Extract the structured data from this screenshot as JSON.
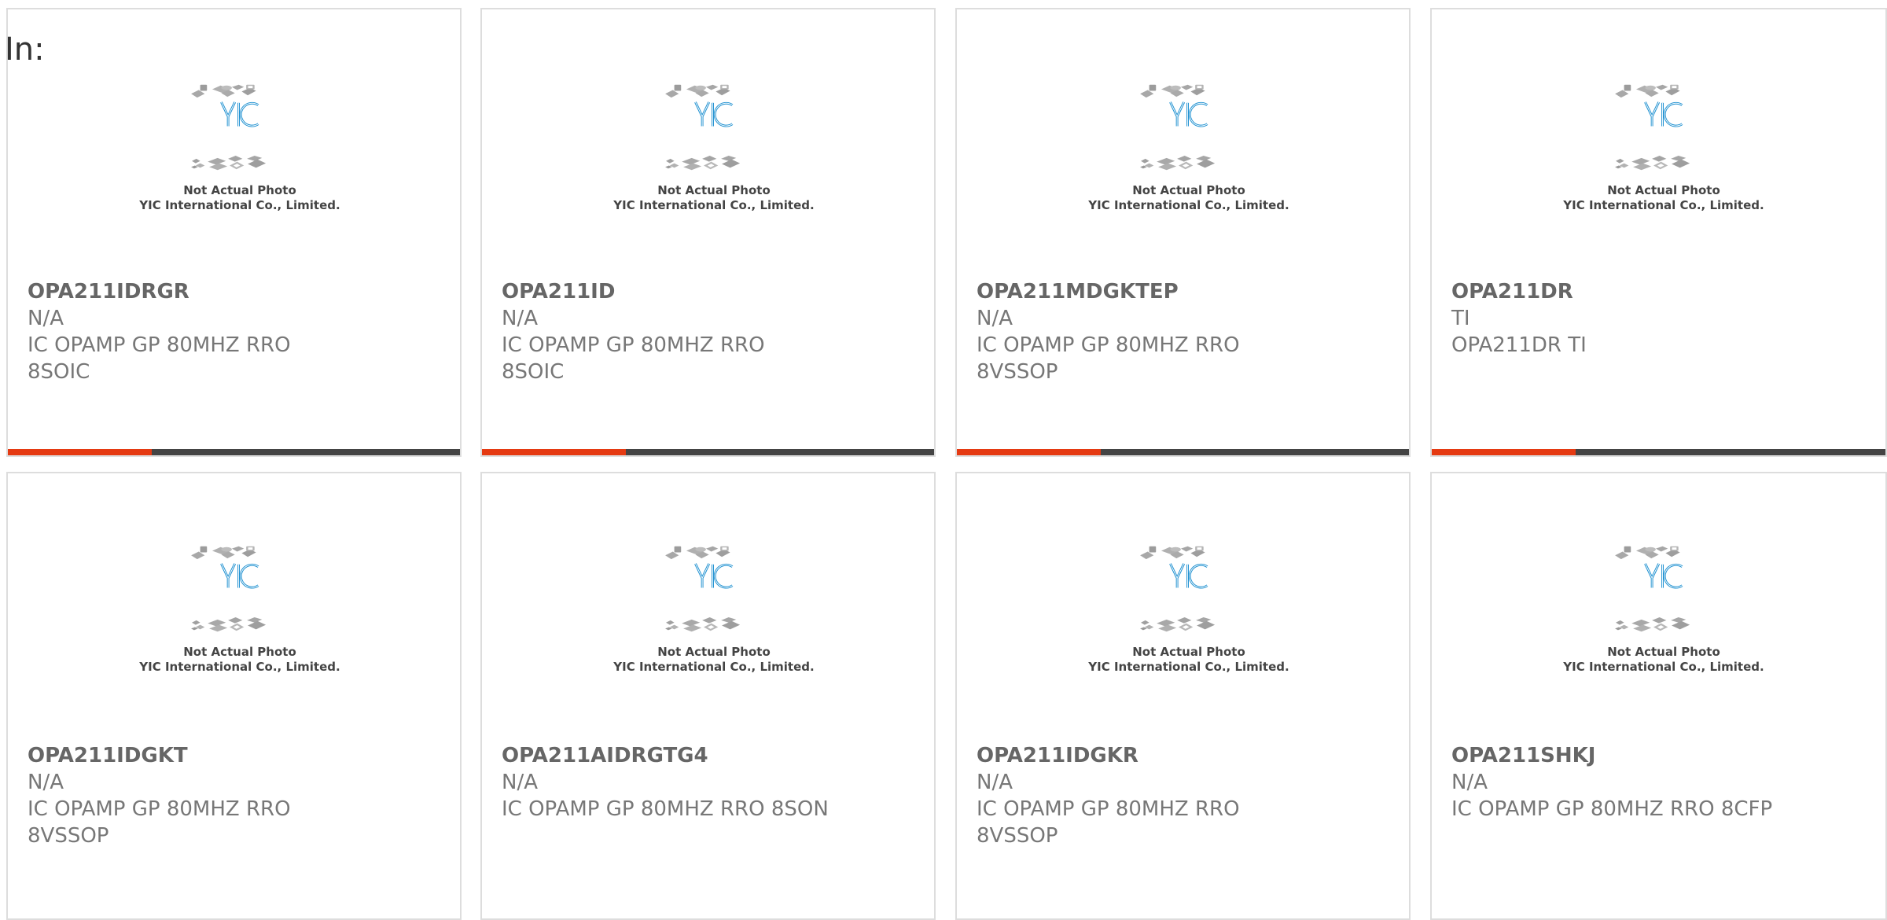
{
  "header": {
    "in_label": "In:"
  },
  "placeholder": {
    "logo_text": "YIC",
    "caption_line1": "Not Actual Photo",
    "caption_line2": "YIC International Co., Limited."
  },
  "colors": {
    "accent": "#e53a12",
    "bar": "#444444",
    "logo_blue": "#1b8fd0"
  },
  "products": [
    {
      "part_number": "OPA211IDRGR",
      "manufacturer": "N/A",
      "description": "IC OPAMP GP 80MHZ RRO 8SOIC"
    },
    {
      "part_number": "OPA211ID",
      "manufacturer": "N/A",
      "description": "IC OPAMP GP 80MHZ RRO 8SOIC"
    },
    {
      "part_number": "OPA211MDGKTEP",
      "manufacturer": "N/A",
      "description_line1": "IC OPAMP GP 80MHZ RRO",
      "description_line2": "8VSSOP"
    },
    {
      "part_number": "OPA211DR",
      "manufacturer": "TI",
      "description": "OPA211DR TI"
    },
    {
      "part_number": "OPA211IDGKT",
      "manufacturer": "N/A",
      "description_line1": "IC OPAMP GP 80MHZ RRO",
      "description_line2": "8VSSOP"
    },
    {
      "part_number": "OPA211AIDRGTG4",
      "manufacturer": "N/A",
      "description": "IC OPAMP GP 80MHZ RRO 8SON"
    },
    {
      "part_number": "OPA211IDGKR",
      "manufacturer": "N/A",
      "description_line1": "IC OPAMP GP 80MHZ RRO",
      "description_line2": "8VSSOP"
    },
    {
      "part_number": "OPA211SHKJ",
      "manufacturer": "N/A",
      "description": "IC OPAMP GP 80MHZ RRO 8CFP"
    }
  ]
}
